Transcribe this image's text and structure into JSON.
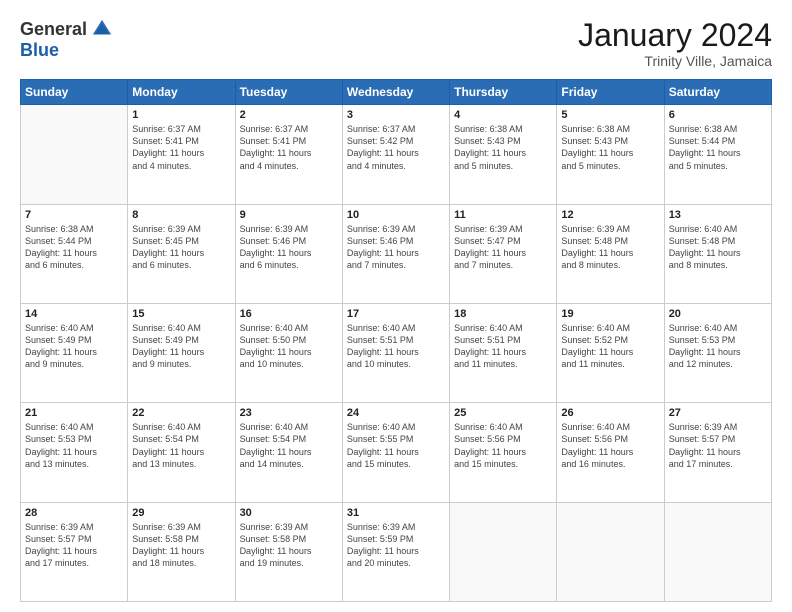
{
  "logo": {
    "general": "General",
    "blue": "Blue"
  },
  "title": "January 2024",
  "subtitle": "Trinity Ville, Jamaica",
  "days_header": [
    "Sunday",
    "Monday",
    "Tuesday",
    "Wednesday",
    "Thursday",
    "Friday",
    "Saturday"
  ],
  "weeks": [
    [
      {
        "num": "",
        "info": ""
      },
      {
        "num": "1",
        "info": "Sunrise: 6:37 AM\nSunset: 5:41 PM\nDaylight: 11 hours\nand 4 minutes."
      },
      {
        "num": "2",
        "info": "Sunrise: 6:37 AM\nSunset: 5:41 PM\nDaylight: 11 hours\nand 4 minutes."
      },
      {
        "num": "3",
        "info": "Sunrise: 6:37 AM\nSunset: 5:42 PM\nDaylight: 11 hours\nand 4 minutes."
      },
      {
        "num": "4",
        "info": "Sunrise: 6:38 AM\nSunset: 5:43 PM\nDaylight: 11 hours\nand 5 minutes."
      },
      {
        "num": "5",
        "info": "Sunrise: 6:38 AM\nSunset: 5:43 PM\nDaylight: 11 hours\nand 5 minutes."
      },
      {
        "num": "6",
        "info": "Sunrise: 6:38 AM\nSunset: 5:44 PM\nDaylight: 11 hours\nand 5 minutes."
      }
    ],
    [
      {
        "num": "7",
        "info": "Sunrise: 6:38 AM\nSunset: 5:44 PM\nDaylight: 11 hours\nand 6 minutes."
      },
      {
        "num": "8",
        "info": "Sunrise: 6:39 AM\nSunset: 5:45 PM\nDaylight: 11 hours\nand 6 minutes."
      },
      {
        "num": "9",
        "info": "Sunrise: 6:39 AM\nSunset: 5:46 PM\nDaylight: 11 hours\nand 6 minutes."
      },
      {
        "num": "10",
        "info": "Sunrise: 6:39 AM\nSunset: 5:46 PM\nDaylight: 11 hours\nand 7 minutes."
      },
      {
        "num": "11",
        "info": "Sunrise: 6:39 AM\nSunset: 5:47 PM\nDaylight: 11 hours\nand 7 minutes."
      },
      {
        "num": "12",
        "info": "Sunrise: 6:39 AM\nSunset: 5:48 PM\nDaylight: 11 hours\nand 8 minutes."
      },
      {
        "num": "13",
        "info": "Sunrise: 6:40 AM\nSunset: 5:48 PM\nDaylight: 11 hours\nand 8 minutes."
      }
    ],
    [
      {
        "num": "14",
        "info": "Sunrise: 6:40 AM\nSunset: 5:49 PM\nDaylight: 11 hours\nand 9 minutes."
      },
      {
        "num": "15",
        "info": "Sunrise: 6:40 AM\nSunset: 5:49 PM\nDaylight: 11 hours\nand 9 minutes."
      },
      {
        "num": "16",
        "info": "Sunrise: 6:40 AM\nSunset: 5:50 PM\nDaylight: 11 hours\nand 10 minutes."
      },
      {
        "num": "17",
        "info": "Sunrise: 6:40 AM\nSunset: 5:51 PM\nDaylight: 11 hours\nand 10 minutes."
      },
      {
        "num": "18",
        "info": "Sunrise: 6:40 AM\nSunset: 5:51 PM\nDaylight: 11 hours\nand 11 minutes."
      },
      {
        "num": "19",
        "info": "Sunrise: 6:40 AM\nSunset: 5:52 PM\nDaylight: 11 hours\nand 11 minutes."
      },
      {
        "num": "20",
        "info": "Sunrise: 6:40 AM\nSunset: 5:53 PM\nDaylight: 11 hours\nand 12 minutes."
      }
    ],
    [
      {
        "num": "21",
        "info": "Sunrise: 6:40 AM\nSunset: 5:53 PM\nDaylight: 11 hours\nand 13 minutes."
      },
      {
        "num": "22",
        "info": "Sunrise: 6:40 AM\nSunset: 5:54 PM\nDaylight: 11 hours\nand 13 minutes."
      },
      {
        "num": "23",
        "info": "Sunrise: 6:40 AM\nSunset: 5:54 PM\nDaylight: 11 hours\nand 14 minutes."
      },
      {
        "num": "24",
        "info": "Sunrise: 6:40 AM\nSunset: 5:55 PM\nDaylight: 11 hours\nand 15 minutes."
      },
      {
        "num": "25",
        "info": "Sunrise: 6:40 AM\nSunset: 5:56 PM\nDaylight: 11 hours\nand 15 minutes."
      },
      {
        "num": "26",
        "info": "Sunrise: 6:40 AM\nSunset: 5:56 PM\nDaylight: 11 hours\nand 16 minutes."
      },
      {
        "num": "27",
        "info": "Sunrise: 6:39 AM\nSunset: 5:57 PM\nDaylight: 11 hours\nand 17 minutes."
      }
    ],
    [
      {
        "num": "28",
        "info": "Sunrise: 6:39 AM\nSunset: 5:57 PM\nDaylight: 11 hours\nand 17 minutes."
      },
      {
        "num": "29",
        "info": "Sunrise: 6:39 AM\nSunset: 5:58 PM\nDaylight: 11 hours\nand 18 minutes."
      },
      {
        "num": "30",
        "info": "Sunrise: 6:39 AM\nSunset: 5:58 PM\nDaylight: 11 hours\nand 19 minutes."
      },
      {
        "num": "31",
        "info": "Sunrise: 6:39 AM\nSunset: 5:59 PM\nDaylight: 11 hours\nand 20 minutes."
      },
      {
        "num": "",
        "info": ""
      },
      {
        "num": "",
        "info": ""
      },
      {
        "num": "",
        "info": ""
      }
    ]
  ]
}
